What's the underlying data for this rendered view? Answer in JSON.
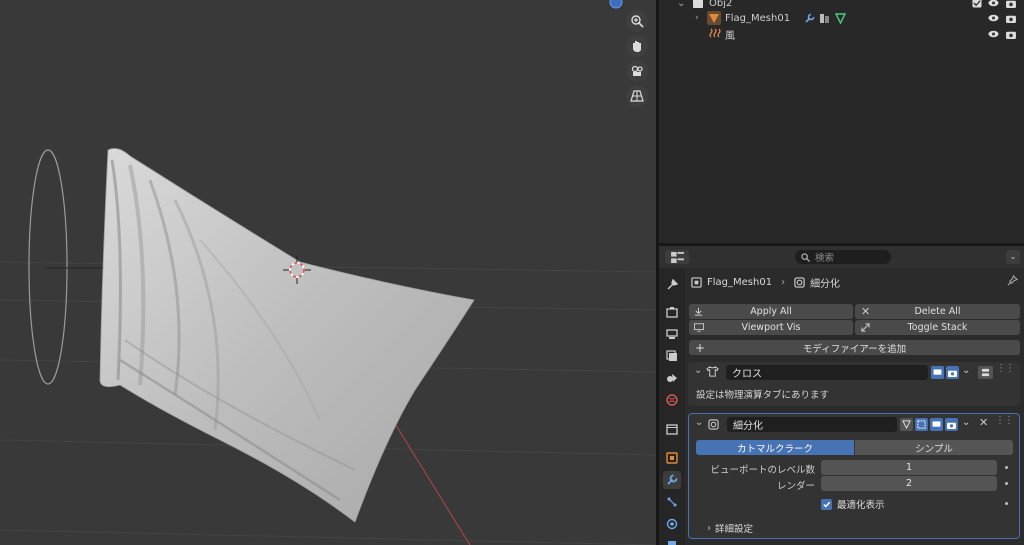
{
  "outliner": {
    "obj2_label": "Obj2",
    "flag_mesh_label": "Flag_Mesh01",
    "wind_label": "風"
  },
  "properties": {
    "search_placeholder": "検索",
    "breadcrumb_object": "Flag_Mesh01",
    "breadcrumb_modifier": "細分化",
    "apply_all": "Apply All",
    "delete_all": "Delete All",
    "viewport_vis": "Viewport Vis",
    "toggle_stack": "Toggle Stack",
    "add_modifier": "モディファイアーを追加",
    "cloth_modifier": {
      "name": "クロス",
      "note": "設定は物理演算タブにあります"
    },
    "subdiv_modifier": {
      "name": "細分化",
      "tab_catmull": "カトマルクラーク",
      "tab_simple": "シンプル",
      "viewport_levels_label": "ビューポートのレベル数",
      "viewport_levels": "1",
      "render_label": "レンダー",
      "render_levels": "2",
      "optimal_display_label": "最適化表示",
      "optimal_display": true,
      "advanced_label": "詳細設定"
    }
  },
  "colors": {
    "accent_blue": "#4772b3",
    "mesh_orange": "#e08a3c",
    "modifier_blue": "#6ea8e8",
    "vertex_green": "#4fc97e",
    "wind_orange": "#e0874a",
    "axis_red": "#b04848"
  }
}
